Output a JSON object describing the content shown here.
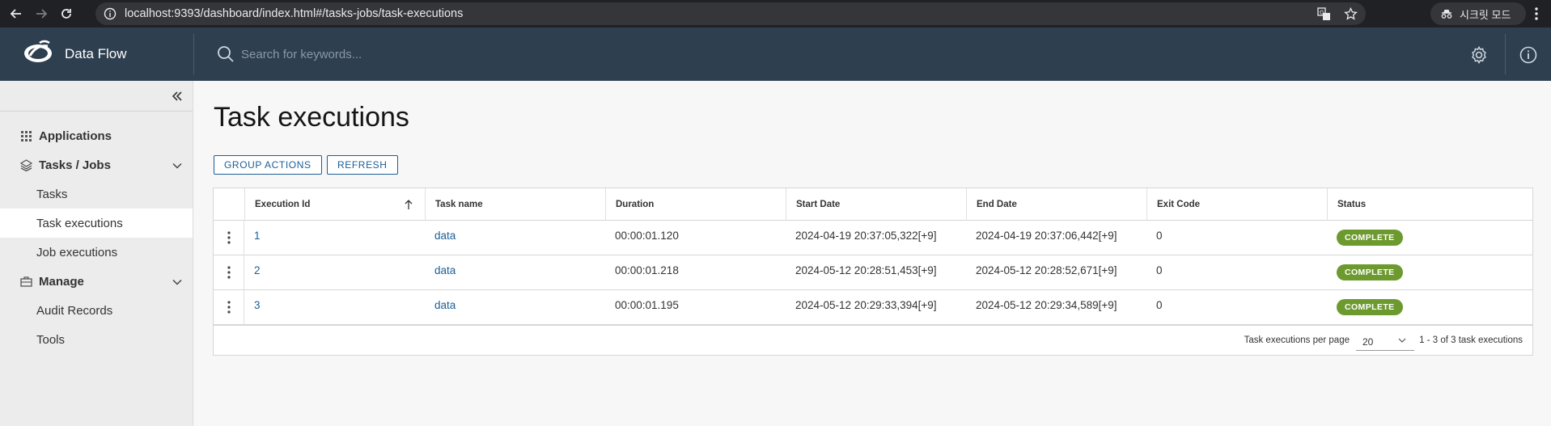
{
  "browser": {
    "url": "localhost:9393/dashboard/index.html#/tasks-jobs/task-executions",
    "profile_label": "시크릿 모드"
  },
  "header": {
    "brand": "Data Flow",
    "search_placeholder": "Search for keywords..."
  },
  "sidebar": {
    "groups": [
      {
        "label": "Applications",
        "icon": "grid-icon"
      },
      {
        "label": "Tasks / Jobs",
        "icon": "layers-icon",
        "items": [
          "Tasks",
          "Task executions",
          "Job executions"
        ]
      },
      {
        "label": "Manage",
        "icon": "briefcase-icon",
        "items": [
          "Audit Records",
          "Tools"
        ]
      }
    ],
    "active_item": "Task executions"
  },
  "page": {
    "title": "Task executions",
    "group_actions_label": "GROUP ACTIONS",
    "refresh_label": "REFRESH"
  },
  "table": {
    "columns": [
      "Execution Id",
      "Task name",
      "Duration",
      "Start Date",
      "End Date",
      "Exit Code",
      "Status"
    ],
    "rows": [
      {
        "id": "1",
        "task": "data",
        "duration": "00:00:01.120",
        "start": "2024-04-19 20:37:05,322[+9]",
        "end": "2024-04-19 20:37:06,442[+9]",
        "exit": "0",
        "status": "COMPLETE"
      },
      {
        "id": "2",
        "task": "data",
        "duration": "00:00:01.218",
        "start": "2024-05-12 20:28:51,453[+9]",
        "end": "2024-05-12 20:28:52,671[+9]",
        "exit": "0",
        "status": "COMPLETE"
      },
      {
        "id": "3",
        "task": "data",
        "duration": "00:00:01.195",
        "start": "2024-05-12 20:29:33,394[+9]",
        "end": "2024-05-12 20:29:34,589[+9]",
        "exit": "0",
        "status": "COMPLETE"
      }
    ],
    "per_page_label": "Task executions per page",
    "per_page_value": "20",
    "range_label": "1 - 3 of 3 task executions"
  },
  "colors": {
    "header_bg": "#2e3f50",
    "link": "#1b5e95",
    "status_complete": "#6d9a2f"
  }
}
